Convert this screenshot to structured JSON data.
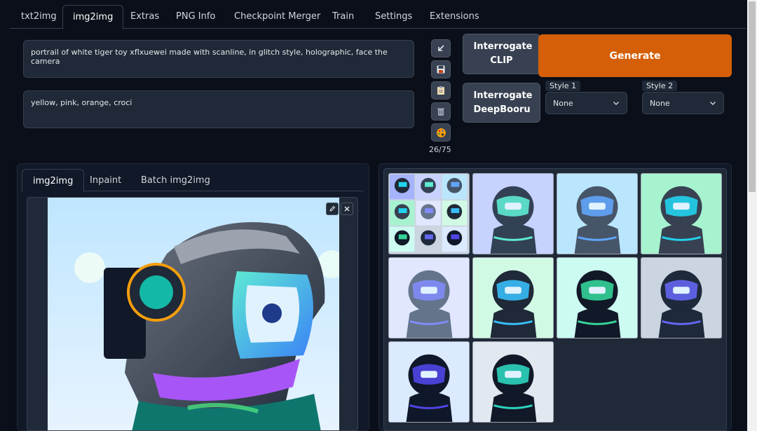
{
  "tabs": [
    "txt2img",
    "img2img",
    "Extras",
    "PNG Info",
    "Checkpoint Merger",
    "Train",
    "Settings",
    "Extensions"
  ],
  "active_tab": "img2img",
  "prompt": {
    "positive": "portrail of white tiger toy xflxuewei made with scanline, in glitch style, holographic, face the camera",
    "negative": "yellow, pink, orange, croci",
    "token_count": "26/75"
  },
  "tools": {
    "icons": [
      "arrow-icon",
      "save-icon",
      "clipboard-icon",
      "trash-icon",
      "palette-icon"
    ]
  },
  "buttons": {
    "interrogate_clip": "Interrogate CLIP",
    "interrogate_deepbooru": "Interrogate DeepBooru",
    "generate": "Generate"
  },
  "styles": {
    "style1_label": "Style 1",
    "style1_value": "None",
    "style2_label": "Style 2",
    "style2_value": "None"
  },
  "subtabs": [
    "img2img",
    "Inpaint",
    "Batch img2img"
  ],
  "active_subtab": "img2img",
  "colors": {
    "generate": "#d45f08",
    "background": "#0b0f19",
    "panel": "#1f2937"
  }
}
